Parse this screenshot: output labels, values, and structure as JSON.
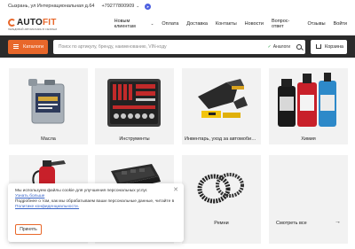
{
  "topbar": {
    "address": "Сызрань, ул Интернациональная д.64",
    "phone": "+79277800909",
    "chevron_icon": "chevron-down-icon",
    "telegram_icon": "telegram-icon"
  },
  "header": {
    "logo_main_a": "AUTO",
    "logo_main_b": "FIT",
    "logo_sub": "ПЕРЕДОВЫЙ АВТОМАГАЗИН В СЫЗРАНИ",
    "nav": [
      "Новым клиентам",
      "Оплата",
      "Доставка",
      "Контакты",
      "Новости",
      "Вопрос-ответ",
      "Отзывы"
    ],
    "login": "Войти"
  },
  "searchbar": {
    "catalog_label": "Каталоги",
    "placeholder": "Поиск по артикулу, бренду, наименованию, VIN-коду",
    "analog_label": "Аналоги",
    "cart_label": "Корзина"
  },
  "categories": [
    {
      "label": "Масла",
      "icon": "oil-can-image"
    },
    {
      "label": "Инструменты",
      "icon": "tool-set-image"
    },
    {
      "label": "Инвентарь, уход за автомобилем",
      "icon": "car-vacuum-image"
    },
    {
      "label": "Химия",
      "icon": "car-chemicals-image"
    },
    {
      "label": "",
      "icon": "fire-extinguisher-image"
    },
    {
      "label": "",
      "icon": "car-mats-image"
    },
    {
      "label": "Ремни",
      "icon": "belts-image"
    },
    {
      "label": "Смотреть все",
      "icon": "arrow-right-icon"
    }
  ],
  "see_all_arrow": "→",
  "cookie": {
    "line1": "Мы используем файлы cookie для улучшения персональных услуг.",
    "link1": "Узнать больше",
    "line2": "Подробнее о том, как мы обрабатываем ваши персональные данные, читайте в",
    "link2": "Политике конфиденциальности.",
    "accept": "Принять",
    "close": "✕"
  },
  "colors": {
    "accent": "#e8672a",
    "searchbar_bg": "#2b2b2b",
    "card_bg": "#f2f2f2"
  }
}
